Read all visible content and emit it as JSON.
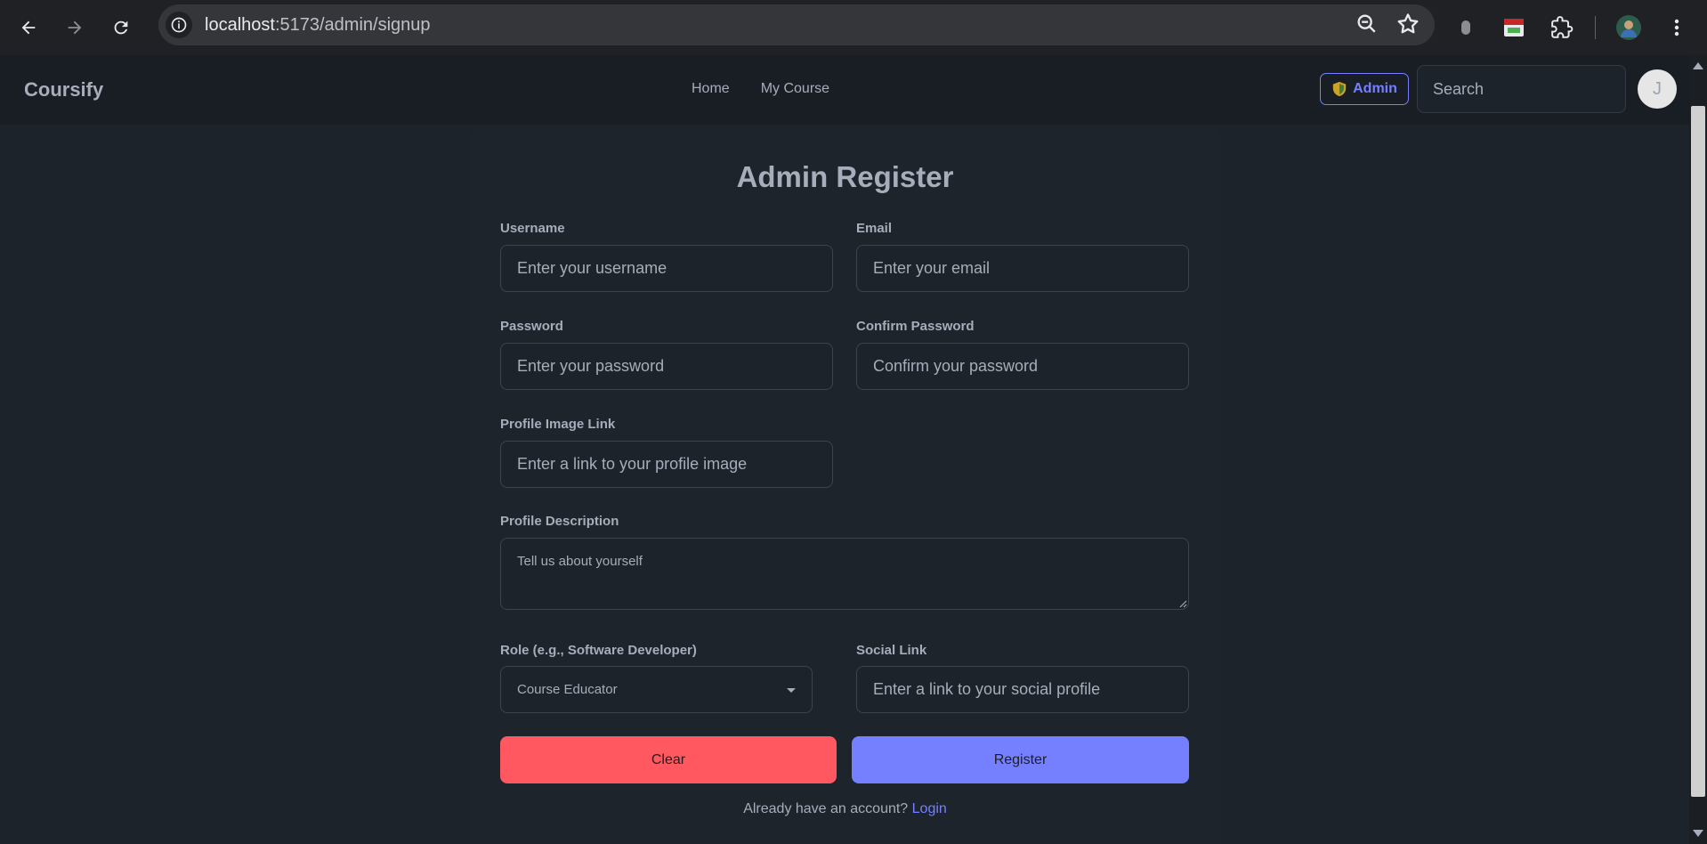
{
  "browser": {
    "url_host": "localhost",
    "url_path": ":5173/admin/signup"
  },
  "navbar": {
    "brand": "Coursify",
    "links": [
      "Home",
      "My Course"
    ],
    "admin_badge": "Admin",
    "search_placeholder": "Search",
    "avatar_initial": "J"
  },
  "form": {
    "title": "Admin Register",
    "username_label": "Username",
    "username_placeholder": "Enter your username",
    "email_label": "Email",
    "email_placeholder": "Enter your email",
    "password_label": "Password",
    "password_placeholder": "Enter your password",
    "confirm_label": "Confirm Password",
    "confirm_placeholder": "Confirm your password",
    "profile_image_label": "Profile Image Link",
    "profile_image_placeholder": "Enter a link to your profile image",
    "description_label": "Profile Description",
    "description_placeholder": "Tell us about yourself",
    "role_label": "Role (e.g., Software Developer)",
    "role_value": "Course Educator",
    "social_label": "Social Link",
    "social_placeholder": "Enter a link to your social profile",
    "clear_label": "Clear",
    "register_label": "Register",
    "footer_text": "Already have an account?",
    "login_link": "Login"
  },
  "colors": {
    "accent": "#7480ff",
    "danger": "#ff5861",
    "background": "#1d232a"
  }
}
